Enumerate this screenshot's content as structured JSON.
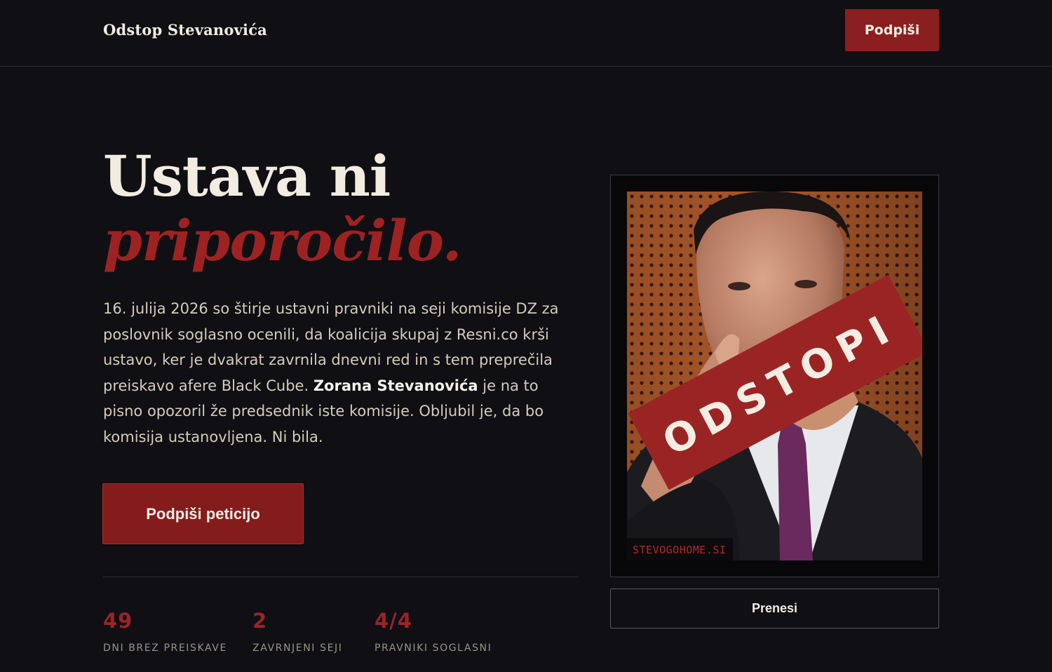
{
  "header": {
    "brand": "Odstop Stevanovića",
    "sign_button": "Podpiši"
  },
  "hero": {
    "title_line1": "Ustava ni",
    "title_line2": "priporočilo.",
    "intro_part1": "16. julija 2026 so štirje ustavni pravniki na seji komisije DZ za poslovnik soglasno ocenili, da koalicija skupaj z Resni.co krši ustavo, ker je dvakrat zavrnila dnevni red in s tem preprečila preiskavo afere Black Cube. ",
    "intro_bold": "Zorana Stevanovića",
    "intro_part2": " je na to pisno opozoril že predsednik iste komisije. Obljubil je, da bo komisija ustanovljena. Ni bila.",
    "cta_button": "Podpiši peticijo"
  },
  "stats": [
    {
      "value": "49",
      "label": "DNI BREZ PREISKAVE"
    },
    {
      "value": "2",
      "label": "ZAVRNJENI SEJI"
    },
    {
      "value": "4/4",
      "label": "PRAVNIKI SOGLASNI"
    }
  ],
  "poster": {
    "stamp_text": "ODSTOPI",
    "watermark": "STEVOGOHOME.SI",
    "download_button": "Prenesi"
  },
  "colors": {
    "background": "#0f0f14",
    "accent": "#8b1f1f",
    "text": "#e8e0d2"
  }
}
